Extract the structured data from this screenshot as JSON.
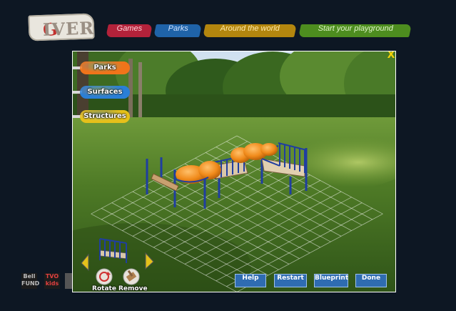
{
  "header": {
    "logo_text": "GIVER",
    "logo_colors": {
      "first_letter": "#c2302d",
      "rest": "#9a8f84"
    },
    "nav": [
      {
        "label": "Games",
        "color": "#b3223a",
        "text_color": "#ffd1d8"
      },
      {
        "label": "Parks",
        "color": "#1f63a8",
        "text_color": "#cfe2ff"
      },
      {
        "label": "Around the world",
        "color": "#b3860e",
        "text_color": "#ffe9a8"
      },
      {
        "label": "Start your playground",
        "color": "#4d8d1f",
        "text_color": "#e0f5c9"
      }
    ]
  },
  "game": {
    "close_icon": "X",
    "side_menu": [
      {
        "label": "Parks",
        "color": "#f0741a"
      },
      {
        "label": "Surfaces",
        "color": "#2a7fd6"
      },
      {
        "label": "Structures",
        "color": "#e6c01a"
      }
    ],
    "tools": {
      "rotate_label": "Rotate",
      "remove_label": "Remove",
      "prev_arrow": "arrow-left-icon",
      "next_arrow": "arrow-right-icon"
    },
    "controls": {
      "help": "Help",
      "restart": "Restart",
      "blueprint": "Blueprint",
      "done": "Done"
    }
  },
  "sponsors": {
    "bell": "Bell\nFUND",
    "tvo": "TVO\nkids"
  }
}
